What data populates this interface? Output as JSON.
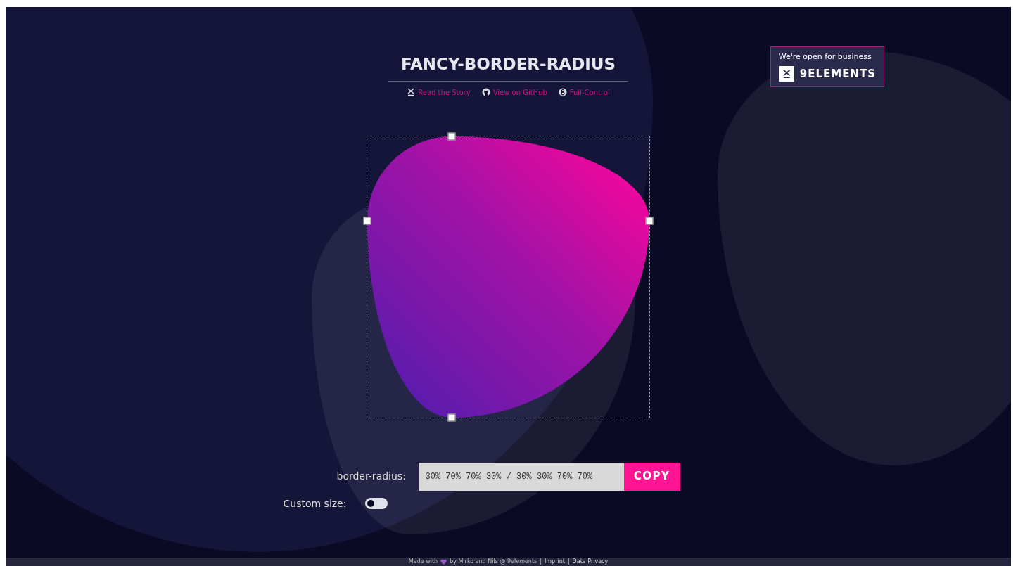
{
  "title": "FANCY-BORDER-RADIUS",
  "links": [
    {
      "kind": "story",
      "label": "Read the Story"
    },
    {
      "kind": "github",
      "label": "View on GitHub"
    },
    {
      "kind": "control",
      "label": "Full-Control"
    }
  ],
  "badge": {
    "tagline": "We're open for business",
    "brand": "9ELEMENTS"
  },
  "border_radius": {
    "label": "border-radius:",
    "value": "30% 70% 70% 30% / 30% 30% 70% 70%",
    "button": "COPY"
  },
  "custom_size": {
    "label": "Custom size:",
    "on": false
  },
  "footer": [
    {
      "kind": "text",
      "text": "Made with"
    },
    {
      "kind": "heart"
    },
    {
      "kind": "text",
      "text": "by Mirko and Nils @ 9elements"
    },
    {
      "kind": "separator",
      "text": "|"
    },
    {
      "kind": "link",
      "text": "Imprint"
    },
    {
      "kind": "separator",
      "text": "|"
    },
    {
      "kind": "link",
      "text": "Data Privacy"
    }
  ]
}
